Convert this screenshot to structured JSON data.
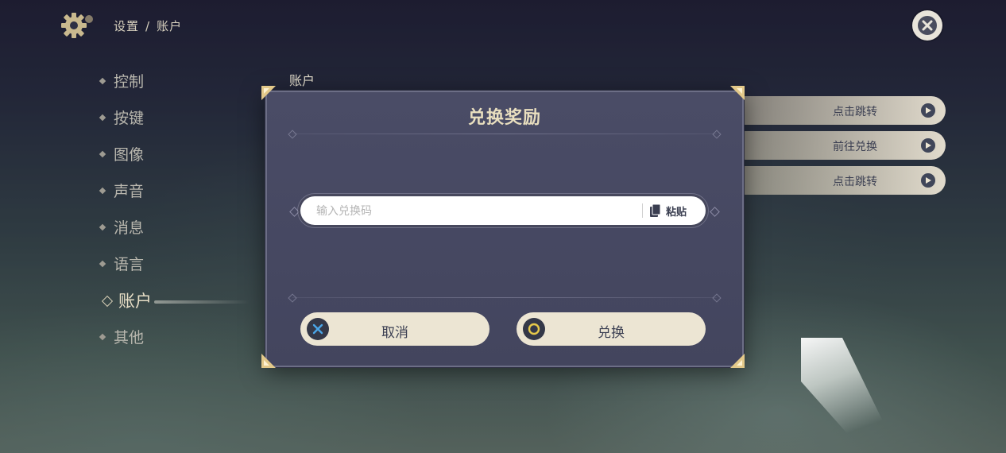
{
  "header": {
    "breadcrumb_root": "设置",
    "breadcrumb_separator": "/",
    "breadcrumb_current": "账户",
    "settings_icon": "gear-icon",
    "close_icon": "close-icon"
  },
  "sidebar": {
    "items": [
      {
        "label": "控制"
      },
      {
        "label": "按键"
      },
      {
        "label": "图像"
      },
      {
        "label": "声音"
      },
      {
        "label": "消息"
      },
      {
        "label": "语言"
      },
      {
        "label": "账户",
        "active": true
      },
      {
        "label": "其他"
      }
    ]
  },
  "main": {
    "section_title": "账户",
    "actions": [
      {
        "label": "点击跳转"
      },
      {
        "label": "前往兑换"
      },
      {
        "label": "点击跳转"
      }
    ]
  },
  "dialog": {
    "title": "兑换奖励",
    "code_input": {
      "value": "",
      "placeholder": "输入兑换码"
    },
    "paste_label": "粘贴",
    "cancel_label": "取消",
    "confirm_label": "兑换"
  },
  "colors": {
    "title_gold": "#e9dfbf",
    "button_bg": "#ece5d3",
    "cancel_accent": "#4aa6e8",
    "confirm_accent": "#e6c94a"
  }
}
